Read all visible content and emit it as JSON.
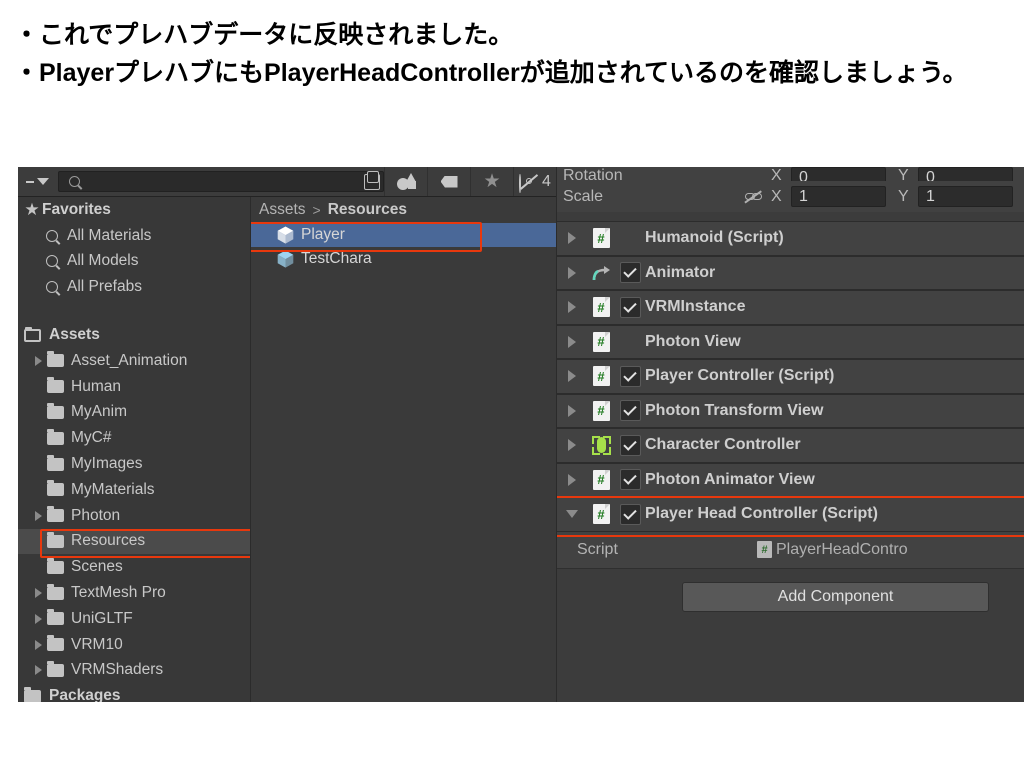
{
  "caption": {
    "line1": "・これでプレハブデータに反映されました。",
    "line2": "・PlayerプレハブにもPlayerHeadControllerが追加されているのを確認しましょう。"
  },
  "toolbar": {
    "search_placeholder": "",
    "search_value": "",
    "hidden_count": "4"
  },
  "sidebar": {
    "favorites": {
      "label": "Favorites",
      "items": [
        {
          "label": "All Materials"
        },
        {
          "label": "All Models"
        },
        {
          "label": "All Prefabs"
        }
      ]
    },
    "assets": {
      "label": "Assets",
      "items": [
        {
          "label": "Asset_Animation",
          "arrow": true,
          "selected": false
        },
        {
          "label": "Human",
          "arrow": false,
          "selected": false
        },
        {
          "label": "MyAnim",
          "arrow": false,
          "selected": false
        },
        {
          "label": "MyC#",
          "arrow": false,
          "selected": false
        },
        {
          "label": "MyImages",
          "arrow": false,
          "selected": false
        },
        {
          "label": "MyMaterials",
          "arrow": false,
          "selected": false
        },
        {
          "label": "Photon",
          "arrow": true,
          "selected": false
        },
        {
          "label": "Resources",
          "arrow": false,
          "selected": true
        },
        {
          "label": "Scenes",
          "arrow": false,
          "selected": false
        },
        {
          "label": "TextMesh Pro",
          "arrow": true,
          "selected": false
        },
        {
          "label": "UniGLTF",
          "arrow": true,
          "selected": false
        },
        {
          "label": "VRM10",
          "arrow": true,
          "selected": false
        },
        {
          "label": "VRMShaders",
          "arrow": true,
          "selected": false
        }
      ]
    },
    "packages": {
      "label": "Packages"
    }
  },
  "assets_panel": {
    "breadcrumb": {
      "root": "Assets",
      "separator": ">",
      "current": "Resources"
    },
    "items": [
      {
        "label": "Player",
        "selected": true,
        "icon_color": "#ffffff"
      },
      {
        "label": "TestChara",
        "selected": false,
        "icon_color": "#9ed4f0"
      }
    ]
  },
  "inspector": {
    "transform": {
      "rotation": {
        "label": "Rotation",
        "x_axis": "X",
        "x": "0",
        "y_axis": "Y",
        "y": "0"
      },
      "scale": {
        "label": "Scale",
        "x_axis": "X",
        "x": "1",
        "y_axis": "Y",
        "y": "1"
      }
    },
    "components": [
      {
        "name": "Humanoid (Script)",
        "icon": "cs-script-icon",
        "expanded": false,
        "checkbox": null
      },
      {
        "name": "Animator",
        "icon": "animator-icon",
        "expanded": false,
        "checkbox": true
      },
      {
        "name": "VRMInstance",
        "icon": "cs-script-icon",
        "expanded": false,
        "checkbox": true
      },
      {
        "name": "Photon View",
        "icon": "cs-script-icon",
        "expanded": false,
        "checkbox": null
      },
      {
        "name": "Player Controller (Script)",
        "icon": "cs-script-icon",
        "expanded": false,
        "checkbox": true
      },
      {
        "name": "Photon Transform View",
        "icon": "cs-script-icon",
        "expanded": false,
        "checkbox": true
      },
      {
        "name": "Character Controller",
        "icon": "character-capsule-icon",
        "expanded": false,
        "checkbox": true
      },
      {
        "name": "Photon Animator View",
        "icon": "cs-script-icon",
        "expanded": false,
        "checkbox": true
      },
      {
        "name": "Player Head Controller (Script)",
        "icon": "cs-script-icon",
        "expanded": true,
        "checkbox": true,
        "highlighted": true
      }
    ],
    "script_field": {
      "label": "Script",
      "value": "PlayerHeadContro"
    },
    "add_component_label": "Add Component"
  },
  "colors": {
    "highlight_red": "#e8380d",
    "selection_blue": "#4a6898",
    "panel_bg": "#383838",
    "script_green": "#1f7a1f",
    "capsule_green": "#a6e04a"
  }
}
